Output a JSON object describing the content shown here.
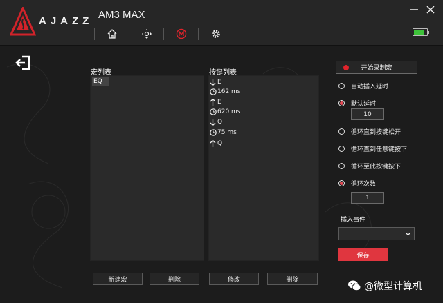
{
  "app": {
    "brand": "AJAZZ",
    "device": "AM3 MAX",
    "battery_level": 0.8,
    "accent_color": "#e0363f",
    "battery_color": "#3ec23a"
  },
  "nav": {
    "items": [
      {
        "icon": "home-icon"
      },
      {
        "icon": "dpi-crosshair-icon"
      },
      {
        "icon": "macro-m-icon",
        "active": true
      },
      {
        "icon": "gear-icon"
      }
    ]
  },
  "window": {
    "minimize_icon": "minimize-icon",
    "close_icon": "close-icon"
  },
  "macro_list": {
    "title": "宏列表",
    "items": [
      "EQ"
    ],
    "new_label": "新建宏",
    "delete_label": "删除"
  },
  "key_list": {
    "title": "按键列表",
    "items": [
      {
        "icon": "key-down-arrow-icon",
        "text": "E"
      },
      {
        "icon": "clock-icon",
        "text": "162 ms"
      },
      {
        "icon": "key-up-arrow-icon",
        "text": "E"
      },
      {
        "icon": "clock-icon",
        "text": "620 ms"
      },
      {
        "icon": "key-down-arrow-icon",
        "text": "Q"
      },
      {
        "icon": "clock-icon",
        "text": "75 ms"
      },
      {
        "icon": "key-up-arrow-icon",
        "text": "Q"
      }
    ],
    "modify_label": "修改",
    "delete_label": "删除"
  },
  "settings": {
    "record_label": "开始录制宏",
    "auto_delay_label": "自动插入延时",
    "default_delay_label": "默认延时",
    "default_delay_value": "10",
    "loop_until_release_label": "循环直到按键松开",
    "loop_until_any_label": "循环直到任意键按下",
    "loop_until_this_label": "循环至此按键按下",
    "loop_count_label": "循环次数",
    "loop_count_value": "1",
    "insert_event_label": "插入事件",
    "insert_event_value": "",
    "save_label": "保存"
  },
  "watermark": {
    "text": "@微型计算机"
  }
}
